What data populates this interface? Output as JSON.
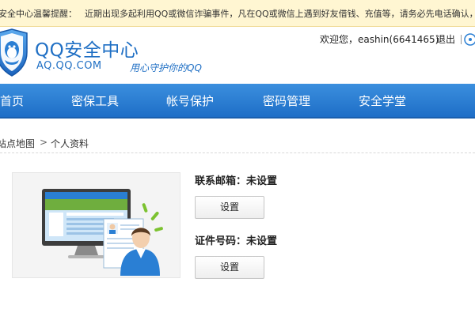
{
  "notice": {
    "title": "安全中心温馨提醒：",
    "text": "近期出现多起利用QQ或微信诈骗事件，凡在QQ或微信上遇到好友借钱、充值等，请务必先电话确认，以防"
  },
  "header": {
    "brand_title": "QQ安全中心",
    "brand_url": "AQ.QQ.COM",
    "slogan": "用心守护你的QQ",
    "welcome": "欢迎您，eashin(6641465)",
    "logout": "退出"
  },
  "nav": {
    "items": [
      {
        "label": "首页"
      },
      {
        "label": "密保工具"
      },
      {
        "label": "帐号保护"
      },
      {
        "label": "密码管理"
      },
      {
        "label": "安全学堂"
      }
    ]
  },
  "breadcrumb": {
    "home": "站点地图",
    "separator": ">",
    "current": "个人资料"
  },
  "profile": {
    "email_label": "联系邮箱：未设置",
    "id_label": "证件号码：未设置",
    "set_label": "设置"
  },
  "colors": {
    "brand": "#1f6fc4",
    "nav": "#2a7fd4",
    "notice_bg": "#fff6d2"
  }
}
